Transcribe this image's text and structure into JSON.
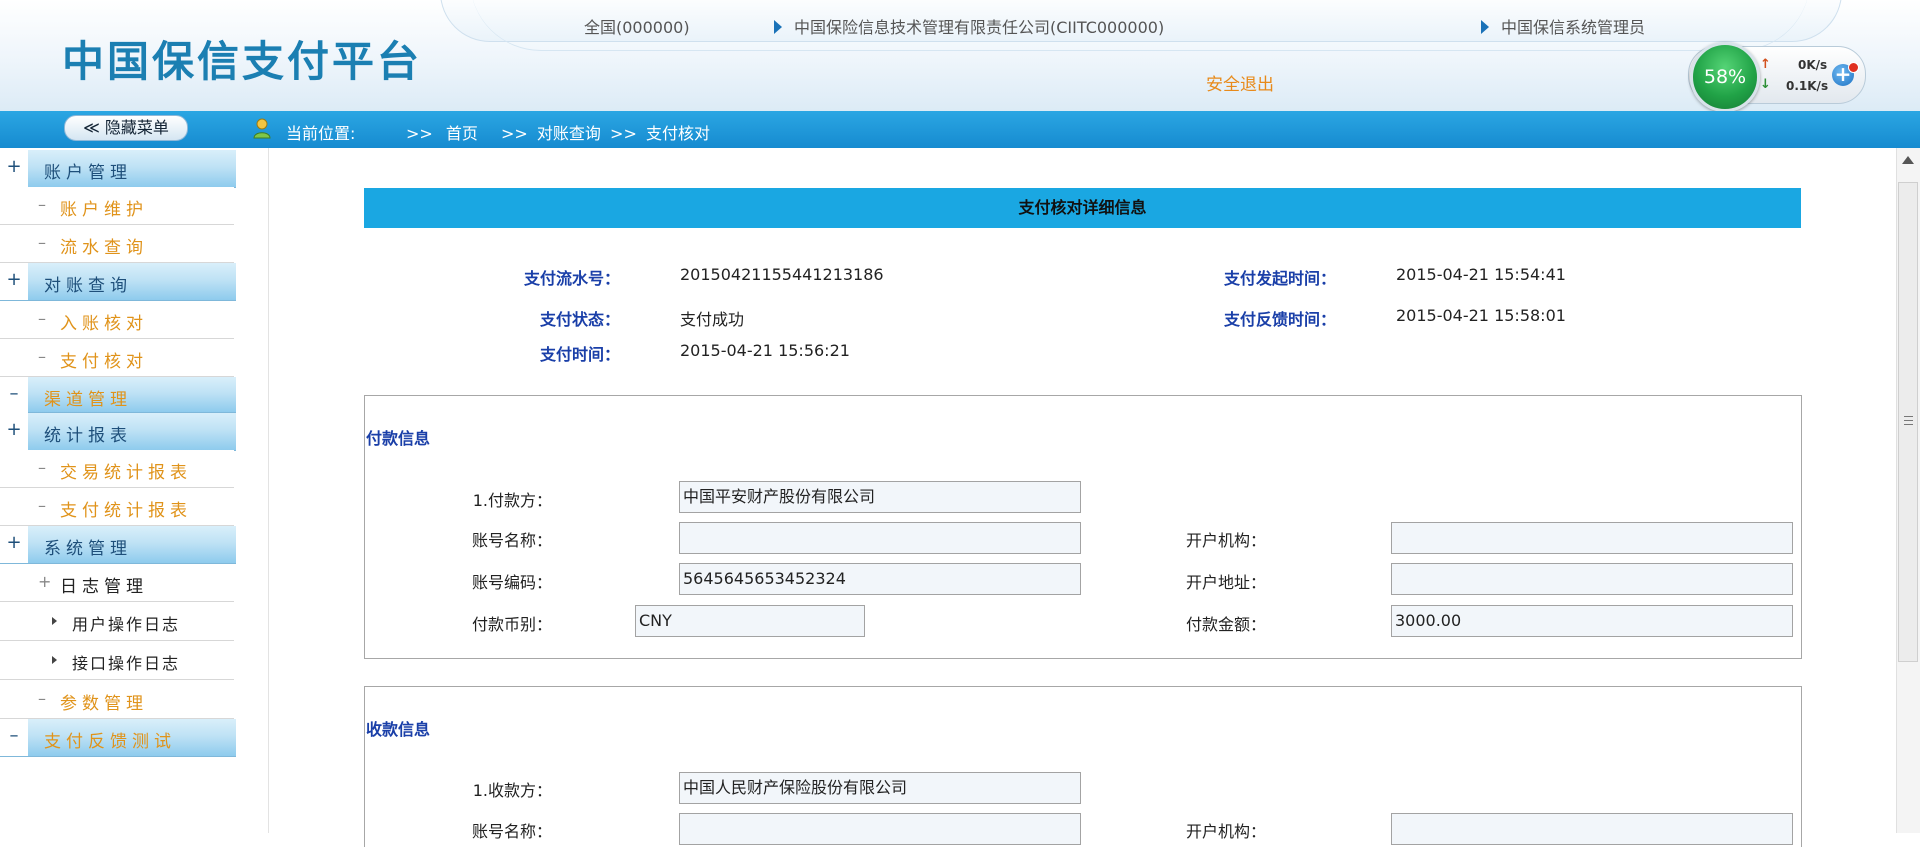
{
  "header": {
    "title": "中国保信支付平台",
    "region": "全国(000000)",
    "company": "中国保险信息技术管理有限责任公司(CIITC000000)",
    "user_role": "中国保信系统管理员",
    "logout": "安全退出"
  },
  "speed_widget": {
    "percent": "58%",
    "upload": "0K/s",
    "download": "0.1K/s",
    "up_arrow": "↑",
    "down_arrow": "↓",
    "plus": "+"
  },
  "navbar": {
    "hide_menu": "≪ 隐藏菜单",
    "location_label": "当前位置:",
    "sep1": ">>",
    "home": "首页",
    "sep2": ">>",
    "crumb1": "对账查询",
    "sep3": ">>",
    "crumb2": "支付核对"
  },
  "sidebar": {
    "items": [
      {
        "lead": "+",
        "label": "账户管理"
      },
      {
        "dash": "–",
        "label": "账户维护"
      },
      {
        "dash": "–",
        "label": "流水查询"
      },
      {
        "lead": "+",
        "label": "对账查询"
      },
      {
        "dash": "–",
        "label": "入账核对"
      },
      {
        "dash": "–",
        "label": "支付核对"
      },
      {
        "lead": "–",
        "label": "渠道管理"
      },
      {
        "lead": "+",
        "label": "统计报表"
      },
      {
        "dash": "–",
        "label": "交易统计报表"
      },
      {
        "dash": "–",
        "label": "支付统计报表"
      },
      {
        "lead": "+",
        "label": "系统管理"
      },
      {
        "dash": "+",
        "label": "日志管理"
      },
      {
        "label": "用户操作日志"
      },
      {
        "label": "接口操作日志"
      },
      {
        "dash": "–",
        "label": "参数管理"
      },
      {
        "lead": "–",
        "label": "支付反馈测试"
      }
    ]
  },
  "detail": {
    "title": "支付核对详细信息",
    "pay_serial_label": "支付流水号：",
    "pay_serial": "20150421155441213186",
    "start_time_label": "支付发起时间：",
    "start_time": "2015-04-21 15:54:41",
    "status_label": "支付状态：",
    "status": "支付成功",
    "feedback_time_label": "支付反馈时间：",
    "feedback_time": "2015-04-21 15:58:01",
    "pay_time_label": "支付时间：",
    "pay_time": "2015-04-21 15:56:21"
  },
  "payer": {
    "section": "付款信息",
    "party_label": "1.付款方：",
    "party": "中国平安财产股份有限公司",
    "account_name_label": "账号名称：",
    "account_name": "",
    "bank_label": "开户机构：",
    "bank": "",
    "account_code_label": "账号编码：",
    "account_code": "5645645653452324",
    "address_label": "开户地址：",
    "address": "",
    "currency_label": "付款币别：",
    "currency": "CNY",
    "amount_label": "付款金额：",
    "amount": "3000.00"
  },
  "payee": {
    "section": "收款信息",
    "party_label": "1.收款方：",
    "party": "中国人民财产保险股份有限公司",
    "account_name_label": "账号名称：",
    "account_name": "",
    "bank_label": "开户机构：",
    "bank": ""
  }
}
